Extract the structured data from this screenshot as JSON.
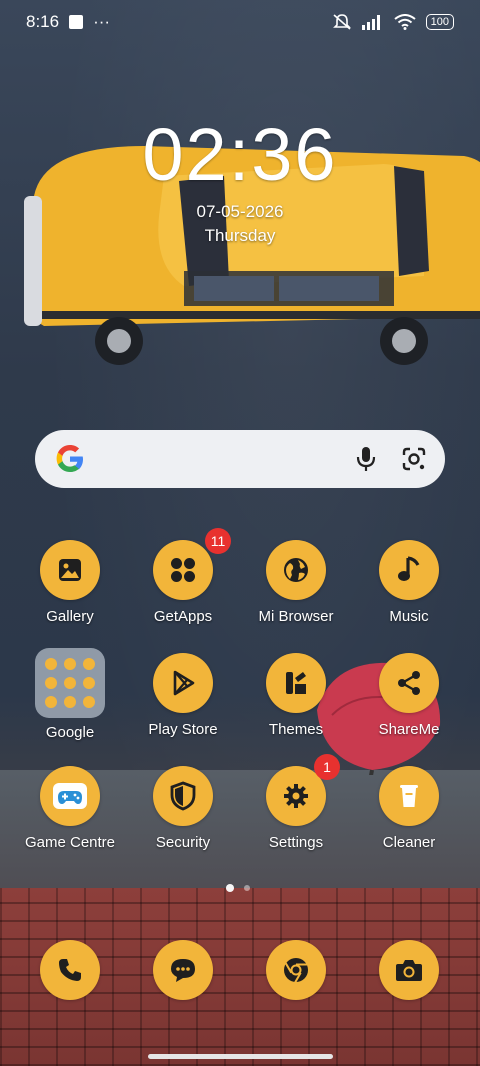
{
  "status_bar": {
    "time": "8:16",
    "more": "···",
    "battery": "100"
  },
  "clock": {
    "time": "02:36",
    "date": "07-05-2026",
    "day": "Thursday"
  },
  "apps": {
    "row1": [
      {
        "label": "Gallery",
        "icon": "gallery-icon"
      },
      {
        "label": "GetApps",
        "icon": "apps-grid-icon",
        "badge": "11"
      },
      {
        "label": "Mi Browser",
        "icon": "globe-icon"
      },
      {
        "label": "Music",
        "icon": "music-note-icon"
      }
    ],
    "row2": [
      {
        "label": "Google",
        "icon": "folder-icon"
      },
      {
        "label": "Play Store",
        "icon": "play-store-icon"
      },
      {
        "label": "Themes",
        "icon": "themes-icon"
      },
      {
        "label": "ShareMe",
        "icon": "share-icon"
      }
    ],
    "row3": [
      {
        "label": "Game Centre",
        "icon": "gamepad-icon"
      },
      {
        "label": "Security",
        "icon": "shield-icon"
      },
      {
        "label": "Settings",
        "icon": "gear-icon",
        "badge": "1"
      },
      {
        "label": "Cleaner",
        "icon": "trash-icon"
      }
    ]
  },
  "dock": [
    {
      "icon": "phone-icon"
    },
    {
      "icon": "message-icon"
    },
    {
      "icon": "chrome-icon"
    },
    {
      "icon": "camera-icon"
    }
  ],
  "colors": {
    "icon_bg": "#f2b53a",
    "badge": "#e8312f"
  }
}
